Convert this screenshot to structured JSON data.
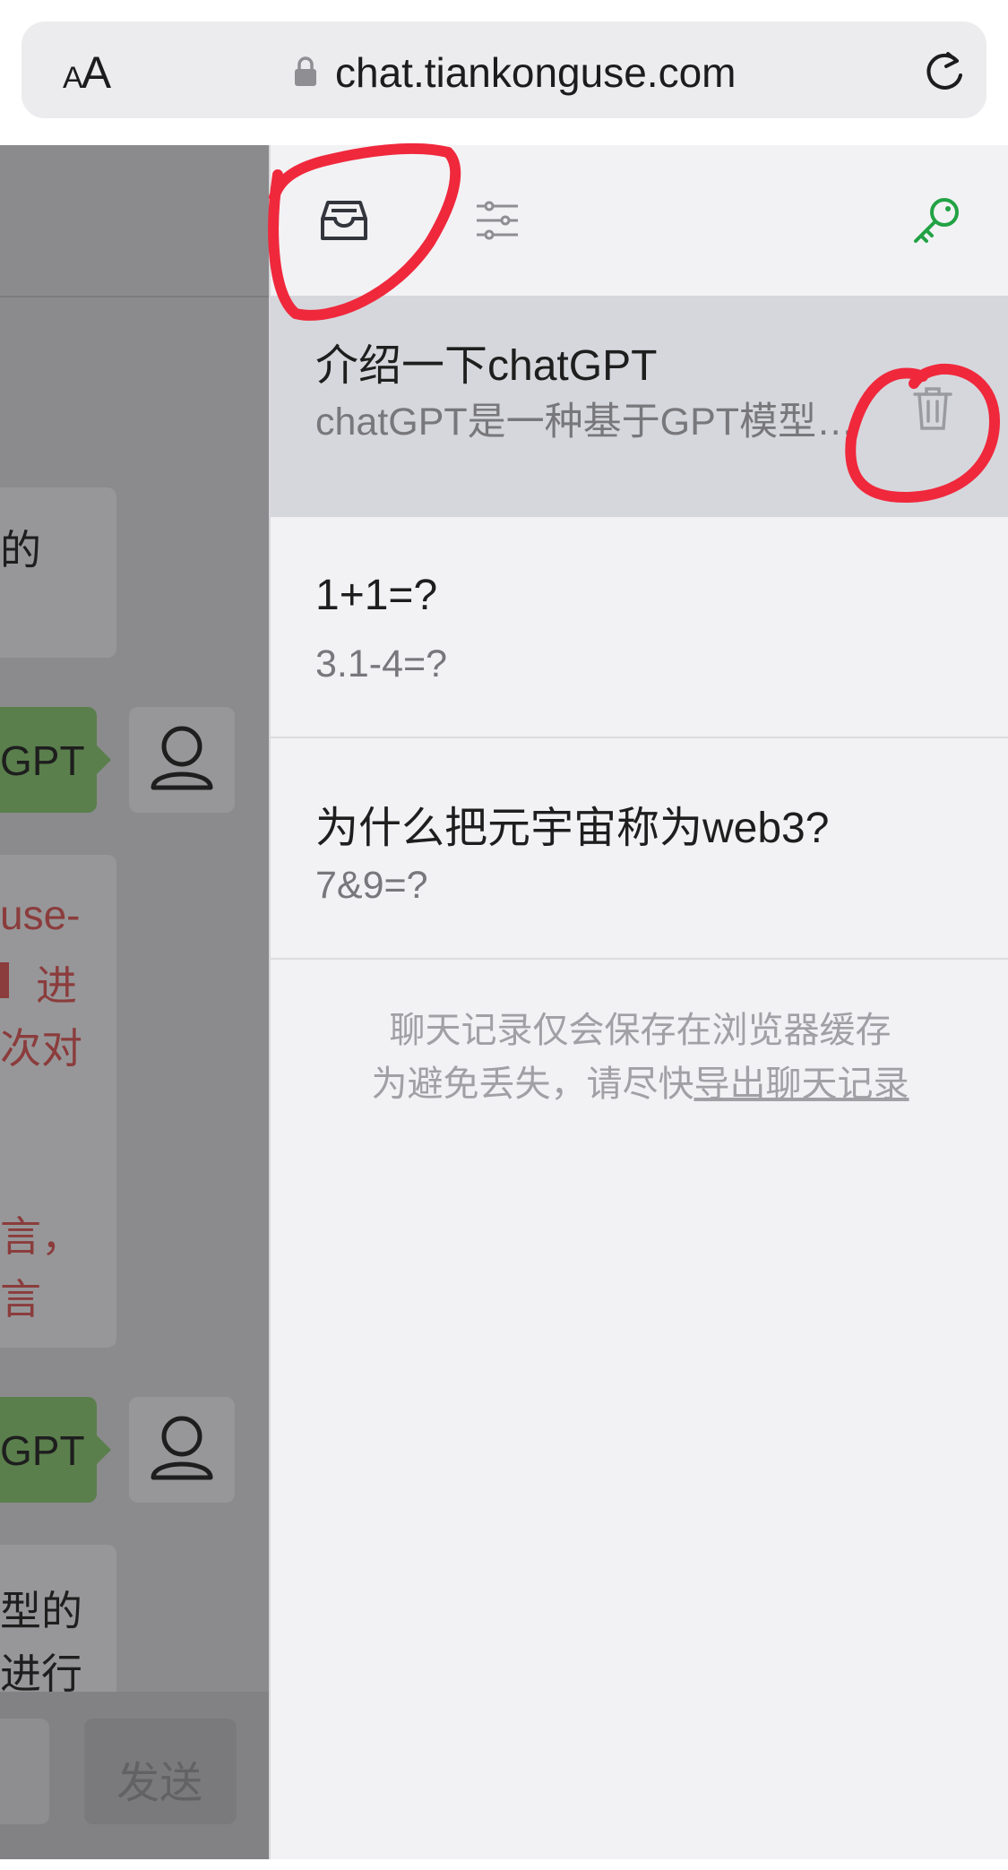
{
  "browser": {
    "aa_small": "A",
    "aa_large": "A",
    "url": "chat.tiankonguse.com"
  },
  "chat": {
    "fragments": {
      "f1": "的",
      "f2": "GPT",
      "f3": "use-",
      "f4": "进",
      "f5": "次对",
      "f6": "言，",
      "f7": "言",
      "f8": "GPT",
      "f9": "型的",
      "f10": "进行"
    },
    "send_label": "发送"
  },
  "sidebar": {
    "conversations": [
      {
        "title": "介绍一下chatGPT",
        "preview": "chatGPT是一种基于GPT模型…",
        "active": true
      },
      {
        "title": "1+1=?",
        "preview": "3.1-4=?",
        "active": false
      },
      {
        "title": "为什么把元宇宙称为web3?",
        "preview": "7&9=?",
        "active": false
      }
    ],
    "footer_line1": "聊天记录仅会保存在浏览器缓存",
    "footer_line2_prefix": "为避免丢失，请尽快",
    "footer_link": "导出聊天记录"
  },
  "icons": {
    "inbox": "inbox-icon",
    "settings": "sliders-icon",
    "key": "key-icon",
    "trash": "trash-icon",
    "lock": "lock-icon",
    "reload": "reload-icon",
    "user": "user-icon"
  },
  "colors": {
    "key_green": "#22a244",
    "annotation_red": "#f0283c",
    "chat_green": "#5a7f4c",
    "error_red": "#8b3c3c"
  }
}
